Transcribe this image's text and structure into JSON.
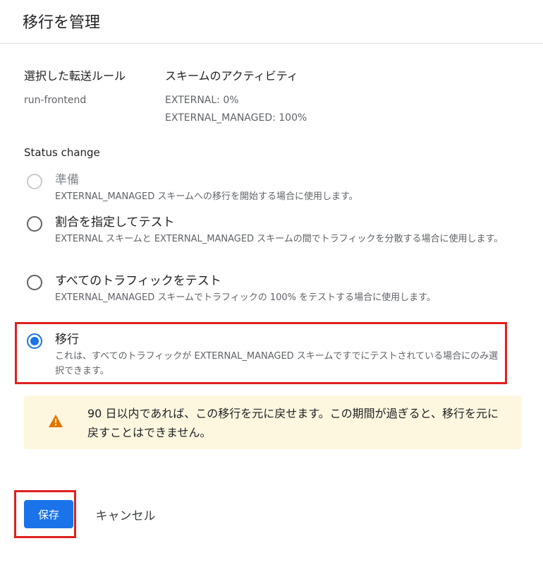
{
  "header": {
    "title": "移行を管理"
  },
  "info": {
    "rule_label": "選択した転送ルール",
    "rule_value": "run-frontend",
    "scheme_label": "スキームのアクティビティ",
    "scheme_values": [
      "EXTERNAL: 0%",
      "EXTERNAL_MANAGED: 100%"
    ]
  },
  "status": {
    "label": "Status change",
    "options": [
      {
        "title": "準備",
        "desc": "EXTERNAL_MANAGED スキームへの移行を開始する場合に使用します。",
        "state": "disabled"
      },
      {
        "title": "割合を指定してテスト",
        "desc": "EXTERNAL スキームと EXTERNAL_MANAGED スキームの間でトラフィックを分散する場合に使用します。",
        "state": "unchecked"
      },
      {
        "title": "すべてのトラフィックをテスト",
        "desc": "EXTERNAL_MANAGED スキームでトラフィックの 100% をテストする場合に使用します。",
        "state": "unchecked"
      },
      {
        "title": "移行",
        "desc": "これは、すべてのトラフィックが EXTERNAL_MANAGED スキームですでにテストされている場合にのみ選択できます。",
        "state": "checked"
      }
    ]
  },
  "warning": {
    "icon": "warning-icon",
    "text": "90 日以内であれば、この移行を元に戻せます。この期間が過ぎると、移行を元に戻すことはできません。"
  },
  "actions": {
    "save_label": "保存",
    "cancel_label": "キャンセル"
  },
  "colors": {
    "accent": "#1a73e8",
    "highlight": "#e02020",
    "warning_bg": "#fef7e0",
    "warning_icon": "#e37400"
  }
}
